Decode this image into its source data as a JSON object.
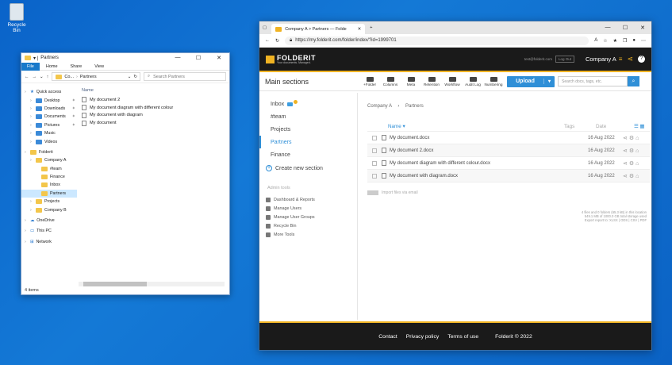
{
  "desktop": {
    "recycle_label": "Recycle Bin"
  },
  "explorer": {
    "title": "Partners",
    "ribbon": [
      "File",
      "Home",
      "Share",
      "View"
    ],
    "address_prefix": "Co...",
    "address_current": "Partners",
    "search_placeholder": "Search Partners",
    "nav": [
      {
        "label": "Quick access",
        "indent": 0,
        "kind": "star"
      },
      {
        "label": "Desktop",
        "indent": 1,
        "kind": "blue",
        "pin": true
      },
      {
        "label": "Downloads",
        "indent": 1,
        "kind": "blue",
        "pin": true
      },
      {
        "label": "Documents",
        "indent": 1,
        "kind": "blue",
        "pin": true
      },
      {
        "label": "Pictures",
        "indent": 1,
        "kind": "blue",
        "pin": true
      },
      {
        "label": "Music",
        "indent": 1,
        "kind": "blue"
      },
      {
        "label": "Videos",
        "indent": 1,
        "kind": "blue"
      },
      {
        "label": "",
        "indent": 0,
        "kind": "gap"
      },
      {
        "label": "Folderit",
        "indent": 0,
        "kind": "folder"
      },
      {
        "label": "Company A",
        "indent": 1,
        "kind": "folder"
      },
      {
        "label": "#team",
        "indent": 2,
        "kind": "folder"
      },
      {
        "label": "Finance",
        "indent": 2,
        "kind": "folder"
      },
      {
        "label": "Inbox",
        "indent": 2,
        "kind": "folder"
      },
      {
        "label": "Partners",
        "indent": 2,
        "kind": "folder",
        "selected": true
      },
      {
        "label": "Projects",
        "indent": 1,
        "kind": "folder"
      },
      {
        "label": "Company B",
        "indent": 1,
        "kind": "folder"
      },
      {
        "label": "",
        "indent": 0,
        "kind": "gap"
      },
      {
        "label": "OneDrive",
        "indent": 0,
        "kind": "cloud"
      },
      {
        "label": "",
        "indent": 0,
        "kind": "gap"
      },
      {
        "label": "This PC",
        "indent": 0,
        "kind": "pc"
      },
      {
        "label": "",
        "indent": 0,
        "kind": "gap"
      },
      {
        "label": "Network",
        "indent": 0,
        "kind": "net"
      }
    ],
    "column_name": "Name",
    "files": [
      "My document 2",
      "My document diagram with different colour",
      "My document with diagram",
      "My document"
    ],
    "status": "4 items"
  },
  "browser": {
    "tab_title": "Company A > Partners — Folde",
    "url": "https://my.folderit.com/folder/index/?id=1999701",
    "header": {
      "logo": "FOLDERIT",
      "tagline": "Your documents. Managed.",
      "email": "test@folderit.com",
      "logout": "Log Out",
      "company": "Company A"
    },
    "main_sections_title": "Main sections",
    "toolbar": [
      "+Folder",
      "Columns",
      "Meta",
      "Retention",
      "Workflow",
      "Audit Log",
      "Numbering"
    ],
    "upload_label": "Upload",
    "search_placeholder": "Search docs, tags, etc.",
    "sections": [
      "Inbox",
      "#team",
      "Projects",
      "Partners",
      "Finance"
    ],
    "create_section": "Create new section",
    "admin_title": "Admin tools",
    "admin_items": [
      "Dashboard & Reports",
      "Manage Users",
      "Manage User Groups",
      "Recycle Bin",
      "More Tools"
    ],
    "breadcrumb": [
      "Company A",
      "Partners"
    ],
    "list_headers": {
      "name": "Name",
      "tags": "Tags",
      "date": "Date"
    },
    "docs": [
      {
        "name": "My document.docx",
        "date": "16 Aug 2022"
      },
      {
        "name": "My document 2.docx",
        "date": "16 Aug 2022"
      },
      {
        "name": "My document diagram with different colour.docx",
        "date": "16 Aug 2022"
      },
      {
        "name": "My document with diagram.docx",
        "date": "16 Aug 2022"
      }
    ],
    "import_label": "Import files via email",
    "stats": [
      "4 files and 0 folders (65.3 kB) in this location",
      "549.1 MB of 1000.0 GB total storage used",
      "Export report to: XLSX | ODS | CSV | PDF"
    ],
    "footer": [
      "Contact",
      "Privacy policy",
      "Terms of use"
    ],
    "copyright": "Folderit © 2022"
  },
  "colors": {
    "accent": "#f0b323",
    "primary": "#2f8fd7",
    "dark": "#1a1a1a"
  }
}
